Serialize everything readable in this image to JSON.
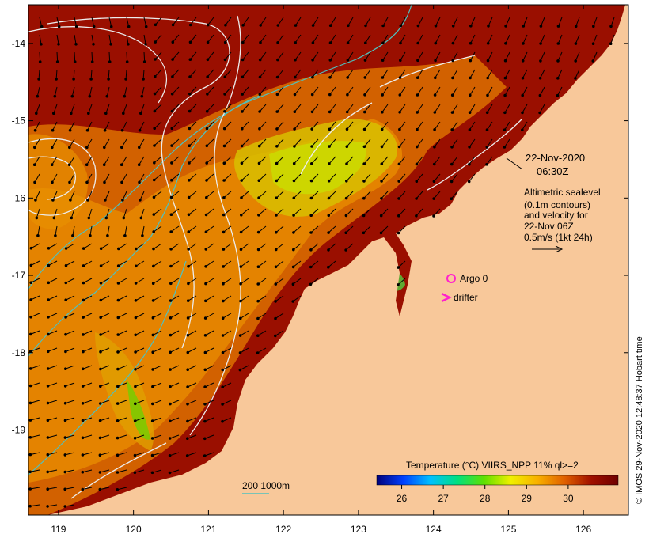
{
  "map": {
    "lon_ticks": [
      "119",
      "120",
      "121",
      "122",
      "123",
      "124",
      "125",
      "126"
    ],
    "lat_ticks": [
      "-14",
      "-15",
      "-16",
      "-17",
      "-18",
      "-19"
    ],
    "lon_range": [
      118.6,
      126.6
    ],
    "lat_range": [
      -13.5,
      -20.1
    ],
    "colors": {
      "land": "#f8c89a",
      "ocean_warm": "#9a0f00",
      "ocean_mid": "#e07800",
      "ocean_cool": "#d6c400",
      "contour": "#e8e8e8",
      "isobath": "#4fc1bf",
      "marker": "#ff22cc"
    }
  },
  "annotations": {
    "date": "22-Nov-2020",
    "time": "06:30Z",
    "legend_lines": [
      "Altimetric sealevel",
      "(0.1m contours)",
      "and velocity for",
      "22-Nov 06Z",
      "0.5m/s (1kt 24h)"
    ],
    "argo_label": "Argo 0",
    "drifter_label": "drifter",
    "depth_label": "200  1000m"
  },
  "colorbar": {
    "title": "Temperature (°C) VIIRS_NPP 11% ql>=2",
    "ticks": [
      "26",
      "27",
      "28",
      "29",
      "30"
    ],
    "min": 25.4,
    "max": 31.2,
    "stops": [
      "#00007a",
      "#0040ff",
      "#00c0ff",
      "#00e080",
      "#60e000",
      "#f0f000",
      "#f8b000",
      "#e06000",
      "#a01000",
      "#700000"
    ]
  },
  "credit": "© IMOS 29-Nov-2020 12:48:37 Hobart time"
}
